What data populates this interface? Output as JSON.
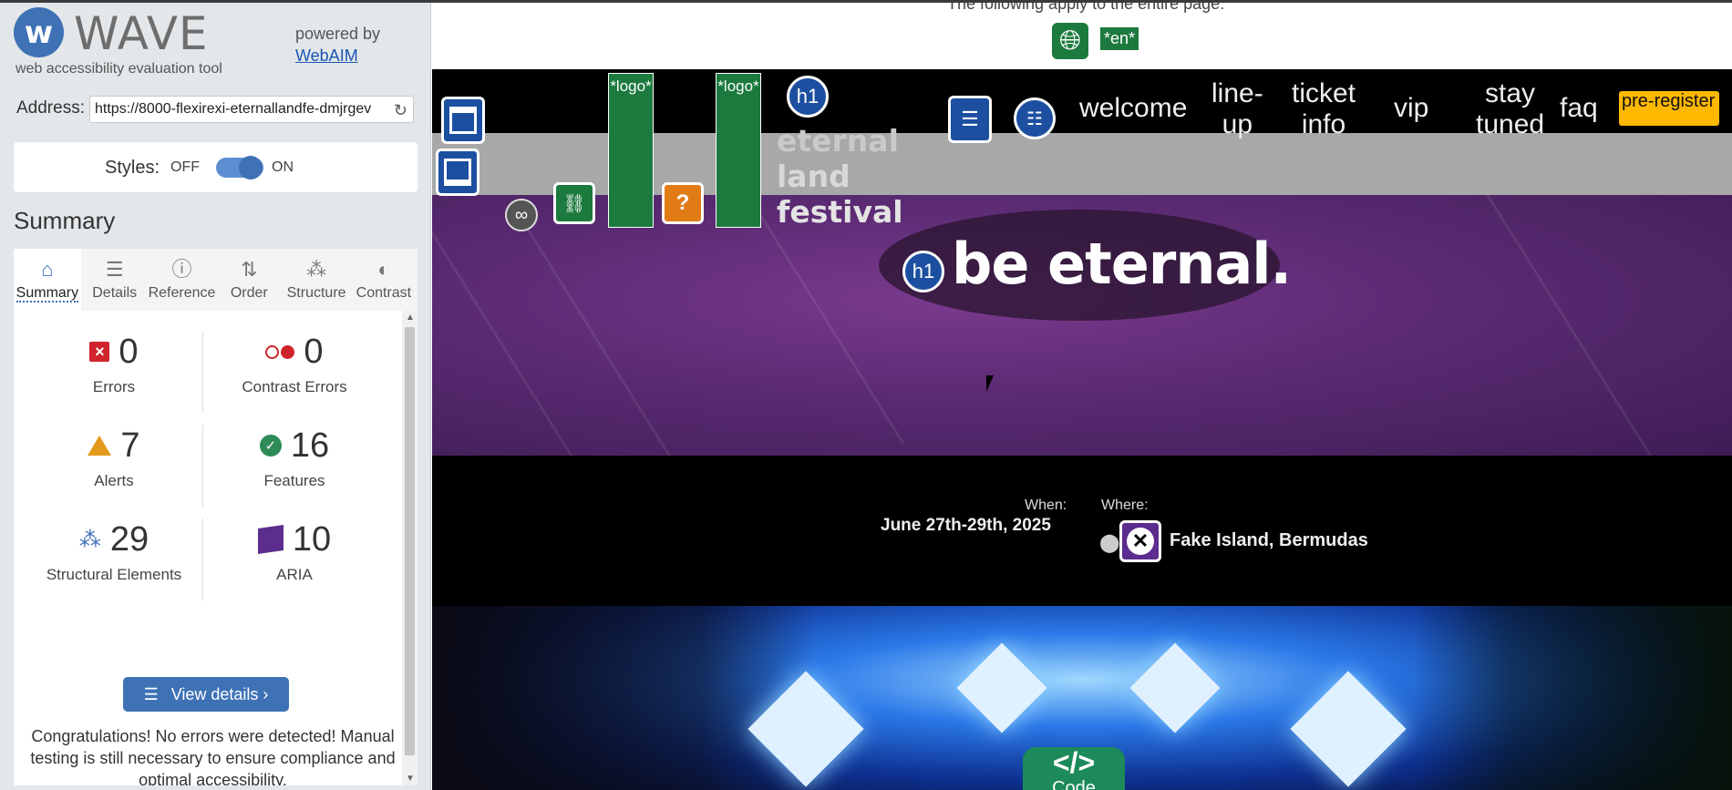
{
  "wave": {
    "logo_letter": "w",
    "logo_word": "WAVE",
    "tagline": "web accessibility evaluation tool",
    "powered_by": "powered by",
    "webaim_link": "WebAIM",
    "address_label": "Address:",
    "address_value": "https://8000-flexirexi-eternallandfe-dmjrgev",
    "styles_label": "Styles:",
    "styles_off": "OFF",
    "styles_on": "ON",
    "summary_heading": "Summary",
    "tabs": [
      {
        "label": "Summary",
        "icon": "home-icon",
        "glyph": "⌂"
      },
      {
        "label": "Details",
        "icon": "list-icon",
        "glyph": "☰"
      },
      {
        "label": "Reference",
        "icon": "info-icon",
        "glyph": "ⓘ"
      },
      {
        "label": "Order",
        "icon": "order-icon",
        "glyph": "⇅"
      },
      {
        "label": "Structure",
        "icon": "structure-icon",
        "glyph": "⁂"
      },
      {
        "label": "Contrast",
        "icon": "contrast-icon",
        "glyph": "◐"
      }
    ],
    "stats": {
      "errors": {
        "count": "0",
        "label": "Errors"
      },
      "contrast_errors": {
        "count": "0",
        "label": "Contrast Errors"
      },
      "alerts": {
        "count": "7",
        "label": "Alerts"
      },
      "features": {
        "count": "16",
        "label": "Features"
      },
      "structural": {
        "count": "29",
        "label": "Structural Elements"
      },
      "aria": {
        "count": "10",
        "label": "ARIA"
      }
    },
    "view_details": "View details ›",
    "congrats": "Congratulations! No errors were detected! Manual testing is still necessary to ensure compliance and optimal accessibility."
  },
  "page": {
    "top_text": "The following apply to the entire page:",
    "lang_tag": "*en*",
    "logo_tag": "*logo*",
    "brand_lines": [
      "eternal",
      "land",
      "festival"
    ],
    "nav": [
      "welcome",
      "line-up",
      "ticket info",
      "vip",
      "stay tuned",
      "faq"
    ],
    "nav_lines": [
      [
        "welcome"
      ],
      [
        "line-",
        "up"
      ],
      [
        "ticket",
        "info"
      ],
      [
        "vip"
      ],
      [
        "stay",
        "tuned"
      ],
      [
        "faq"
      ]
    ],
    "preregister": "pre-register",
    "h1_badge": "h1",
    "tagline": "be eternal.",
    "when_label": "When:",
    "when_value": "June 27th-29th, 2025",
    "where_label": "Where:",
    "where_value": "Fake Island, Bermudas",
    "code_tab_icon": "</>",
    "code_tab_label": "Code"
  },
  "colors": {
    "wave_blue": "#3e72b5",
    "error_red": "#d0242c",
    "alert_orange": "#e39a1c",
    "feature_green": "#2e8b57",
    "aria_purple": "#5b2d8e",
    "preregister_yellow": "#ffb800"
  }
}
